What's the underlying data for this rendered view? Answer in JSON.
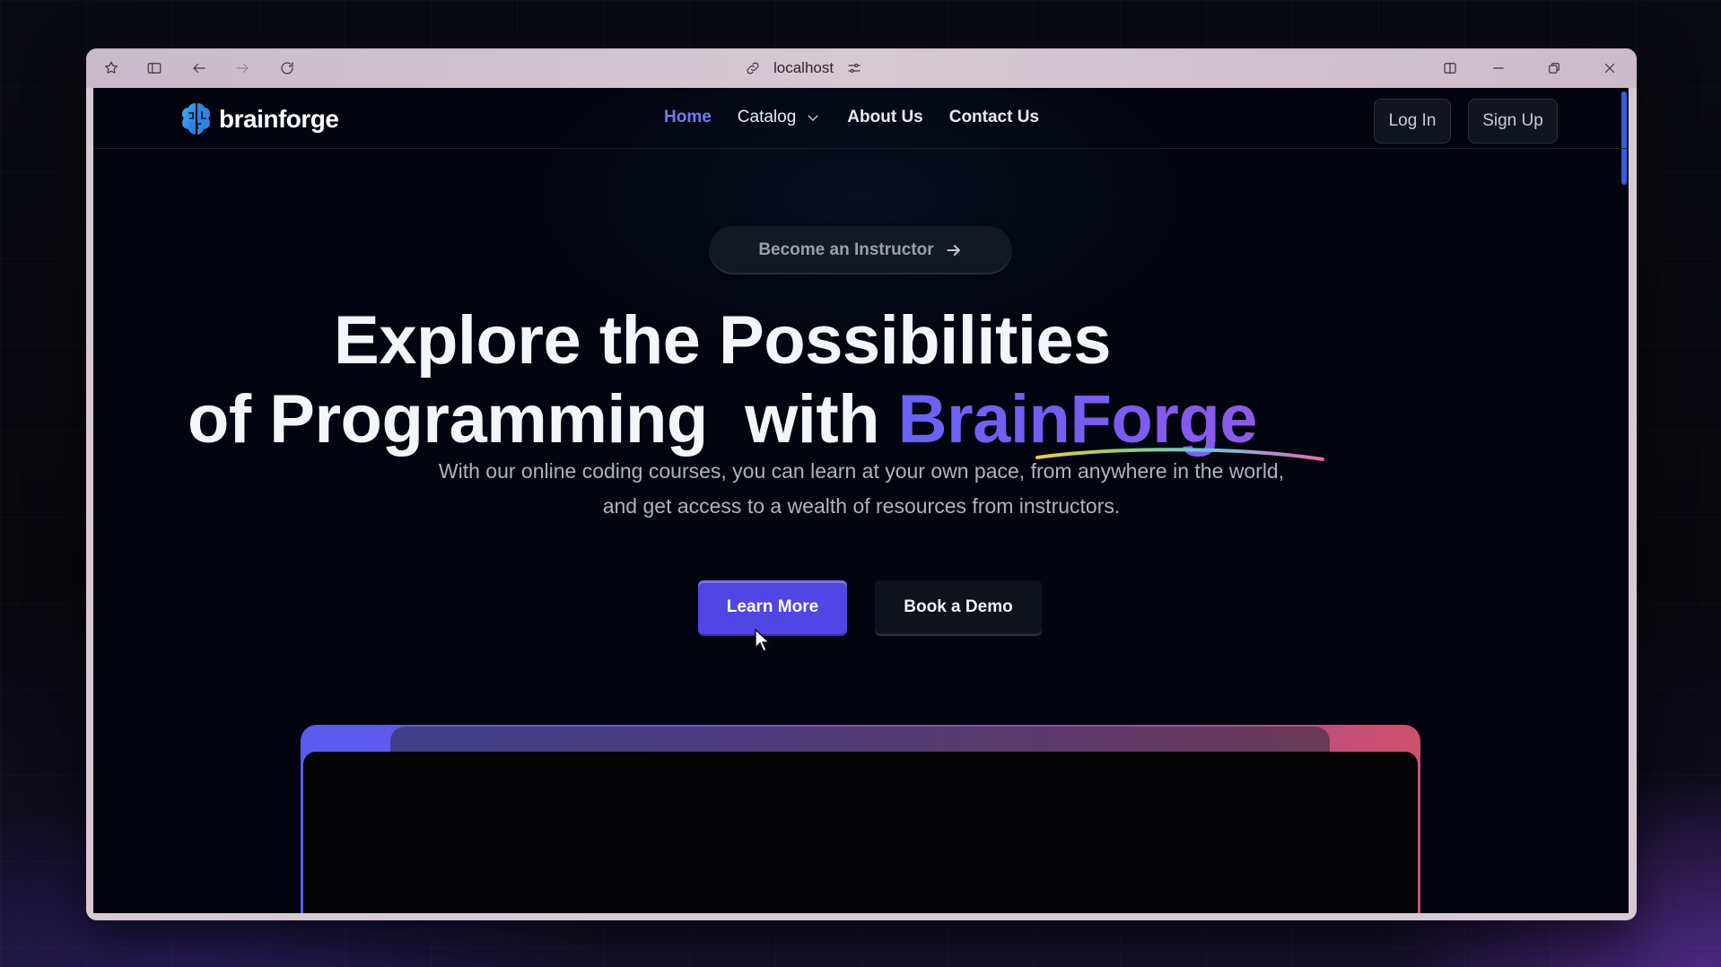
{
  "browser": {
    "url": "localhost",
    "icons": [
      "star-badge-icon",
      "sidebar-icon",
      "back-icon",
      "forward-icon",
      "reload-icon",
      "link-icon",
      "sliders-icon",
      "split-view-icon",
      "minimize-icon",
      "restore-icon",
      "close-icon"
    ]
  },
  "site": {
    "logo_text": "brainforge",
    "nav": {
      "home": "Home",
      "catalog": "Catalog",
      "about": "About Us",
      "contact": "Contact Us"
    },
    "login_label": "Log In",
    "signup_label": "Sign Up"
  },
  "hero": {
    "pill_label": "Become an Instructor",
    "headline_line1": "Explore the Possibilities",
    "headline_line2_prefix": "of Programming  with ",
    "headline_accent": "BrainForge",
    "subtitle": "With our online coding courses, you can learn at your own pace, from anywhere in the world, and get access to a wealth of resources from instructors.",
    "primary_cta": "Learn More",
    "secondary_cta": "Book a Demo"
  },
  "colors": {
    "accent": "#6d62f2",
    "primary_button": "#4f46e5",
    "page_bg": "#02050f",
    "active_nav": "#6f7cf5"
  }
}
